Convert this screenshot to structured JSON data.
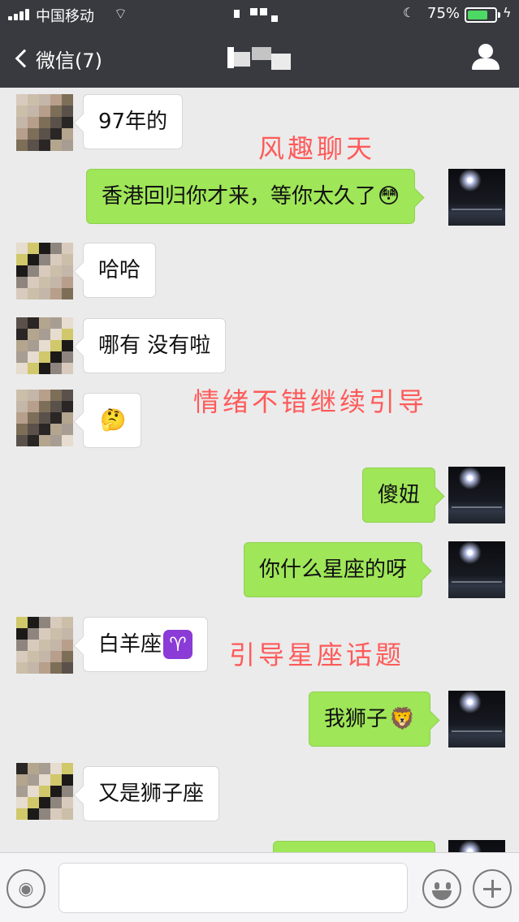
{
  "status_bar": {
    "carrier": "中国移动",
    "battery_percent": "75%",
    "battery_level": 0.75,
    "wifi_icon": "wifi-icon",
    "moon_icon": "do-not-disturb-moon-icon",
    "charging_icon": "charging-bolt-icon"
  },
  "nav": {
    "back_label": "微信(7)",
    "back_icon": "chevron-left-icon",
    "profile_icon": "person-icon"
  },
  "messages": [
    {
      "side": "left",
      "text": "97年的"
    },
    {
      "side": "right",
      "text": "香港回归你才来，等你太久了",
      "emoji": "😳"
    },
    {
      "side": "left",
      "text": "哈哈"
    },
    {
      "side": "left",
      "text": "哪有 没有啦"
    },
    {
      "side": "left",
      "text": "",
      "emoji": "🤔"
    },
    {
      "side": "right",
      "text": "傻妞"
    },
    {
      "side": "right",
      "text": "你什么星座的呀"
    },
    {
      "side": "left",
      "text": "白羊座",
      "emoji": "♈"
    },
    {
      "side": "right",
      "text": "我狮子",
      "emoji": "🦁"
    },
    {
      "side": "left",
      "text": "又是狮子座"
    },
    {
      "side": "right",
      "text": ""
    }
  ],
  "annotations": [
    "风趣聊天",
    "情绪不错继续引导",
    "引导星座话题"
  ],
  "input_bar": {
    "voice_icon": "voice-input-icon",
    "emoji_icon": "emoji-face-icon",
    "add_icon": "plus-circle-icon",
    "input_value": ""
  },
  "colors": {
    "nav_background": "#393a3f",
    "chat_background": "#ebebeb",
    "outgoing_bubble": "#9fe658",
    "incoming_bubble": "#ffffff",
    "annotation_text": "#ff5a5a",
    "battery_green": "#4cd964"
  }
}
